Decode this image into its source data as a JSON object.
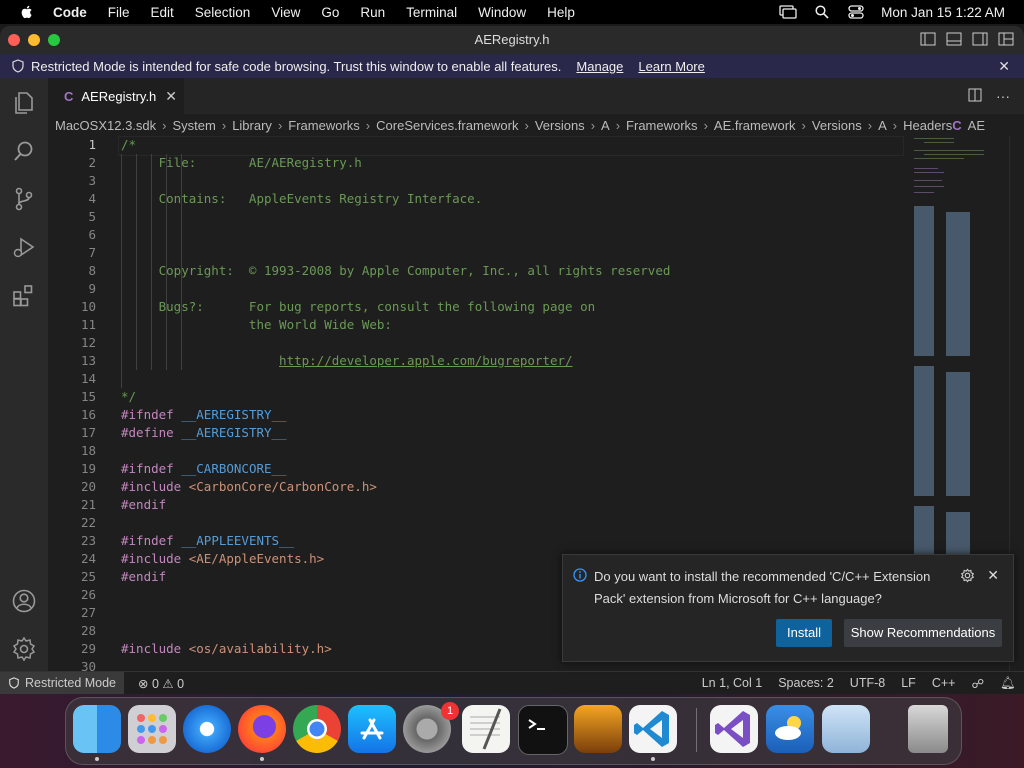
{
  "menubar": {
    "app_name": "Code",
    "menus": [
      "File",
      "Edit",
      "Selection",
      "View",
      "Go",
      "Run",
      "Terminal",
      "Window",
      "Help"
    ],
    "clock": "Mon Jan 15  1:22 AM"
  },
  "window": {
    "title": "AERegistry.h"
  },
  "banner": {
    "text": "Restricted Mode is intended for safe code browsing. Trust this window to enable all features.",
    "manage": "Manage",
    "learn_more": "Learn More"
  },
  "tab": {
    "icon": "C",
    "label": "AERegistry.h"
  },
  "breadcrumb": [
    "MacOSX12.3.sdk",
    "System",
    "Library",
    "Frameworks",
    "CoreServices.framework",
    "Versions",
    "A",
    "Frameworks",
    "AE.framework",
    "Versions",
    "A",
    "Headers",
    "AE"
  ],
  "code_lines": [
    {
      "n": "1",
      "parts": [
        {
          "c": "cm",
          "t": "/*"
        }
      ]
    },
    {
      "n": "2",
      "parts": [
        {
          "c": "cm",
          "t": "     File:       AE/AERegistry.h"
        }
      ]
    },
    {
      "n": "3",
      "parts": []
    },
    {
      "n": "4",
      "parts": [
        {
          "c": "cm",
          "t": "     Contains:   AppleEvents Registry Interface."
        }
      ]
    },
    {
      "n": "5",
      "parts": []
    },
    {
      "n": "6",
      "parts": []
    },
    {
      "n": "7",
      "parts": []
    },
    {
      "n": "8",
      "parts": [
        {
          "c": "cm",
          "t": "     Copyright:  © 1993-2008 by Apple Computer, Inc., all rights reserved"
        }
      ]
    },
    {
      "n": "9",
      "parts": []
    },
    {
      "n": "10",
      "parts": [
        {
          "c": "cm",
          "t": "     Bugs?:      For bug reports, consult the following page on"
        }
      ]
    },
    {
      "n": "11",
      "parts": [
        {
          "c": "cm",
          "t": "                 the World Wide Web:"
        }
      ]
    },
    {
      "n": "12",
      "parts": []
    },
    {
      "n": "13",
      "parts": [
        {
          "c": "cm",
          "t": "                     "
        },
        {
          "c": "url",
          "t": "http://developer.apple.com/bugreporter/"
        }
      ]
    },
    {
      "n": "14",
      "parts": []
    },
    {
      "n": "15",
      "parts": [
        {
          "c": "cm",
          "t": "*/"
        }
      ]
    },
    {
      "n": "16",
      "parts": [
        {
          "c": "pp",
          "t": "#ifndef "
        },
        {
          "c": "mac",
          "t": "__AEREGISTRY__"
        }
      ]
    },
    {
      "n": "17",
      "parts": [
        {
          "c": "pp",
          "t": "#define "
        },
        {
          "c": "mac",
          "t": "__AEREGISTRY__"
        }
      ]
    },
    {
      "n": "18",
      "parts": []
    },
    {
      "n": "19",
      "parts": [
        {
          "c": "pp",
          "t": "#ifndef "
        },
        {
          "c": "mac",
          "t": "__CARBONCORE__"
        }
      ]
    },
    {
      "n": "20",
      "parts": [
        {
          "c": "pp",
          "t": "#include "
        },
        {
          "c": "str",
          "t": "<CarbonCore/CarbonCore.h>"
        }
      ]
    },
    {
      "n": "21",
      "parts": [
        {
          "c": "pp",
          "t": "#endif"
        }
      ]
    },
    {
      "n": "22",
      "parts": []
    },
    {
      "n": "23",
      "parts": [
        {
          "c": "pp",
          "t": "#ifndef "
        },
        {
          "c": "mac",
          "t": "__APPLEEVENTS__"
        }
      ]
    },
    {
      "n": "24",
      "parts": [
        {
          "c": "pp",
          "t": "#include "
        },
        {
          "c": "str",
          "t": "<AE/AppleEvents.h>"
        }
      ]
    },
    {
      "n": "25",
      "parts": [
        {
          "c": "pp",
          "t": "#endif"
        }
      ]
    },
    {
      "n": "26",
      "parts": []
    },
    {
      "n": "27",
      "parts": []
    },
    {
      "n": "28",
      "parts": []
    },
    {
      "n": "29",
      "parts": [
        {
          "c": "pp",
          "t": "#include "
        },
        {
          "c": "str",
          "t": "<os/availability.h>"
        }
      ]
    },
    {
      "n": "30",
      "parts": []
    }
  ],
  "notification": {
    "message": "Do you want to install the recommended 'C/C++ Extension Pack' extension from Microsoft for C++ language?",
    "install": "Install",
    "show_recommendations": "Show Recommendations"
  },
  "statusbar": {
    "restricted": "Restricted Mode",
    "errors": "0",
    "warnings": "0",
    "position": "Ln 1, Col 1",
    "spaces": "Spaces: 2",
    "encoding": "UTF-8",
    "eol": "LF",
    "language": "C++"
  },
  "dock": {
    "apps": [
      "finder",
      "launchpad",
      "safari",
      "firefox",
      "chrome",
      "app-store",
      "system-preferences",
      "textedit",
      "terminal",
      "garageband",
      "vscode",
      "visual-studio",
      "weather",
      "preview",
      "trash"
    ],
    "settings_badge": "1"
  }
}
